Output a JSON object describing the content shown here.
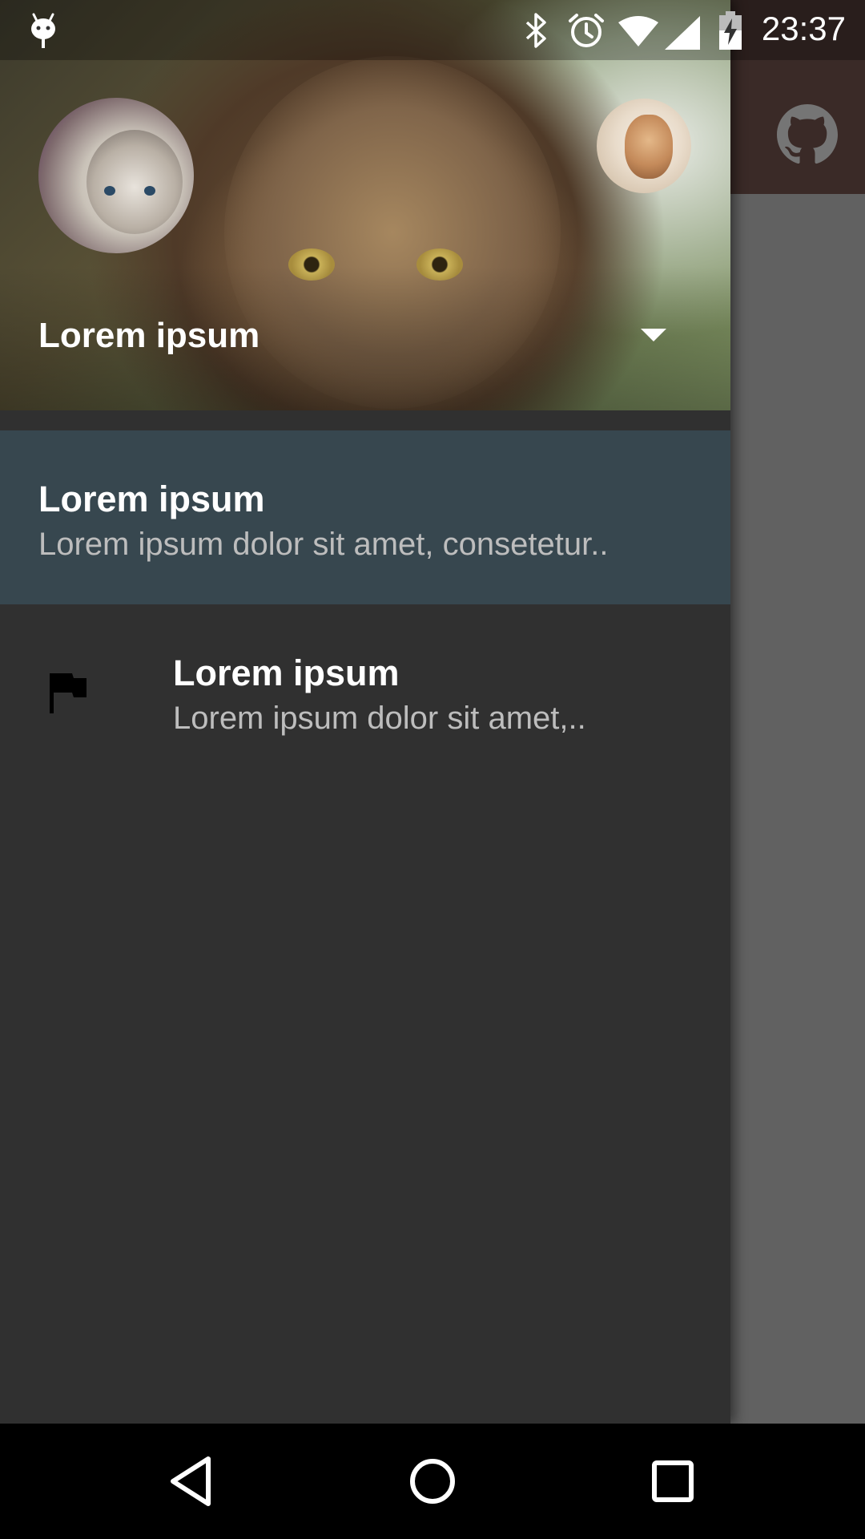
{
  "status_bar": {
    "time": "23:37",
    "icons": [
      "android-debug-icon",
      "bluetooth-icon",
      "alarm-icon",
      "wifi-icon",
      "signal-icon",
      "battery-charging-icon"
    ]
  },
  "app": {
    "toolbar_icon": "github-icon"
  },
  "drawer": {
    "header": {
      "account_name": "Lorem ipsum",
      "dropdown_icon": "arrow-drop-down-icon"
    },
    "items": [
      {
        "title": "Lorem ipsum",
        "description": "Lorem ipsum dolor sit amet, consetetur..",
        "selected": true
      },
      {
        "title": "Lorem ipsum",
        "description": "Lorem ipsum dolor sit amet,..",
        "icon": "flag-icon",
        "selected": false
      }
    ]
  },
  "nav_bar": {
    "buttons": [
      "back-icon",
      "home-icon",
      "recents-icon"
    ]
  },
  "colors": {
    "drawer_bg": "#303030",
    "selected_item_bg": "#37474f",
    "toolbar_bg": "#3a2a27",
    "scrim": "#616161"
  }
}
